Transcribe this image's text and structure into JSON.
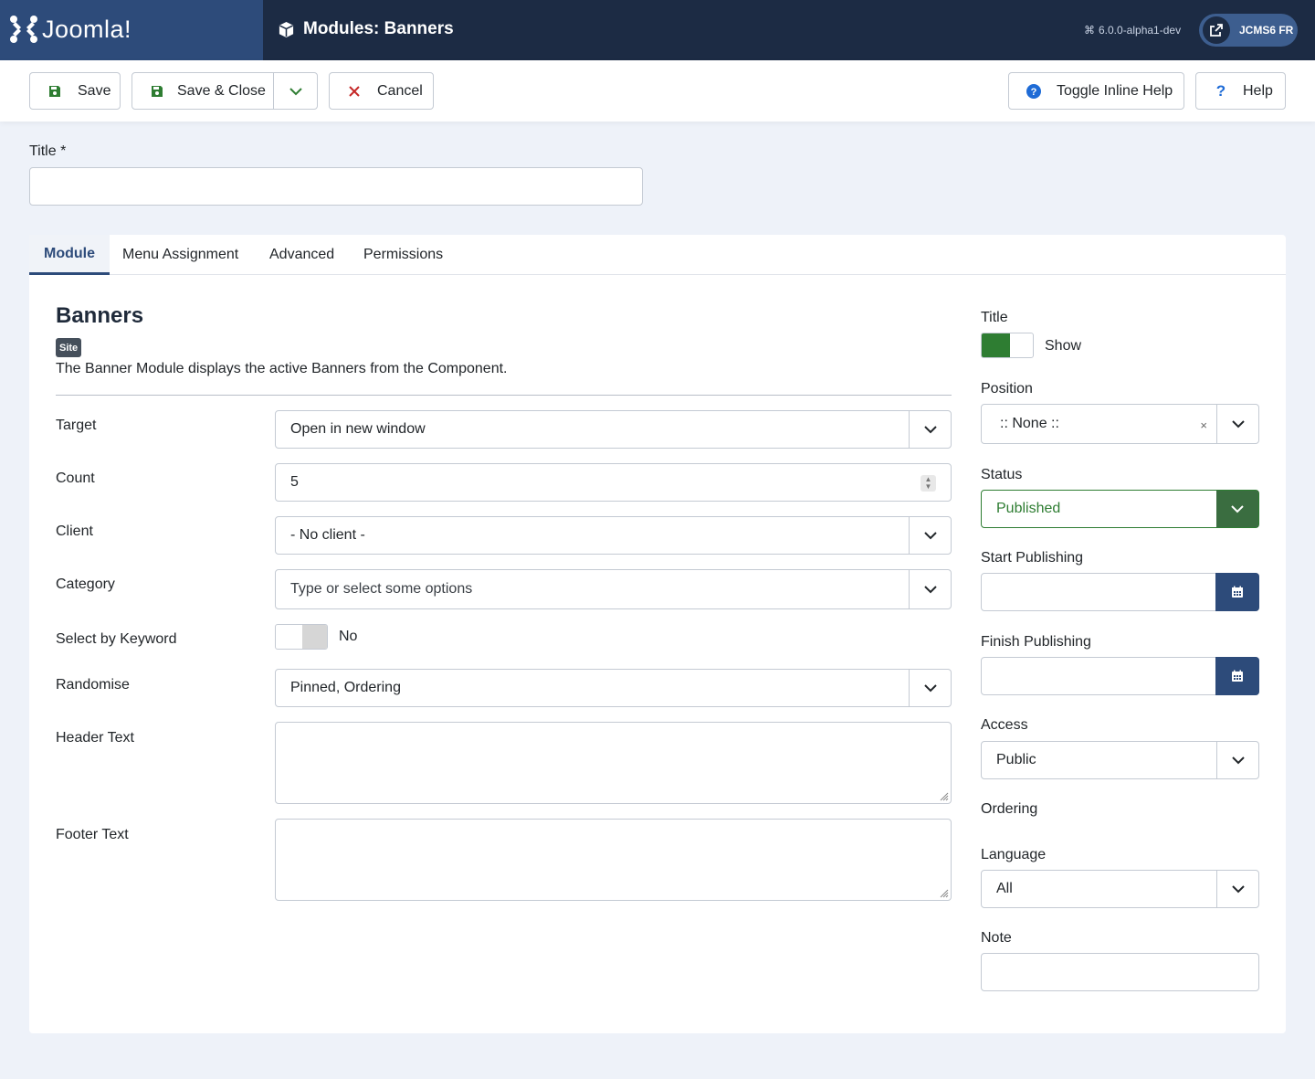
{
  "header": {
    "brand": "Joomla!",
    "page_title": "Modules: Banners",
    "version": "6.0.0-alpha1-dev",
    "site_button": "JCMS6 FR"
  },
  "toolbar": {
    "save": "Save",
    "save_close": "Save & Close",
    "cancel": "Cancel",
    "toggle_help": "Toggle Inline Help",
    "help": "Help"
  },
  "title_field": {
    "label": "Title *",
    "value": ""
  },
  "tabs": [
    {
      "label": "Module",
      "active": true
    },
    {
      "label": "Menu Assignment",
      "active": false
    },
    {
      "label": "Advanced",
      "active": false
    },
    {
      "label": "Permissions",
      "active": false
    }
  ],
  "module": {
    "name": "Banners",
    "badge": "Site",
    "description": "The Banner Module displays the active Banners from the Component."
  },
  "fields": {
    "target": {
      "label": "Target",
      "value": "Open in new window"
    },
    "count": {
      "label": "Count",
      "value": "5"
    },
    "client": {
      "label": "Client",
      "value": "- No client -"
    },
    "category": {
      "label": "Category",
      "placeholder": "Type or select some options"
    },
    "keyword": {
      "label": "Select by Keyword",
      "value": "No"
    },
    "randomise": {
      "label": "Randomise",
      "value": "Pinned, Ordering"
    },
    "header_text": {
      "label": "Header Text",
      "value": ""
    },
    "footer_text": {
      "label": "Footer Text",
      "value": ""
    }
  },
  "sidebar": {
    "title": {
      "label": "Title",
      "value": "Show"
    },
    "position": {
      "label": "Position",
      "value": ":: None ::",
      "clear": "×"
    },
    "status": {
      "label": "Status",
      "value": "Published"
    },
    "start_publishing": {
      "label": "Start Publishing",
      "value": ""
    },
    "finish_publishing": {
      "label": "Finish Publishing",
      "value": ""
    },
    "access": {
      "label": "Access",
      "value": "Public"
    },
    "ordering": {
      "label": "Ordering"
    },
    "language": {
      "label": "Language",
      "value": "All"
    },
    "note": {
      "label": "Note",
      "value": ""
    }
  },
  "colors": {
    "header_bg": "#1c2b44",
    "logo_bg": "#2d4b7a",
    "accent": "#2d4b7a",
    "success": "#2e7d32",
    "cancel_red": "#c52827",
    "help_blue": "#1e6bd6"
  }
}
